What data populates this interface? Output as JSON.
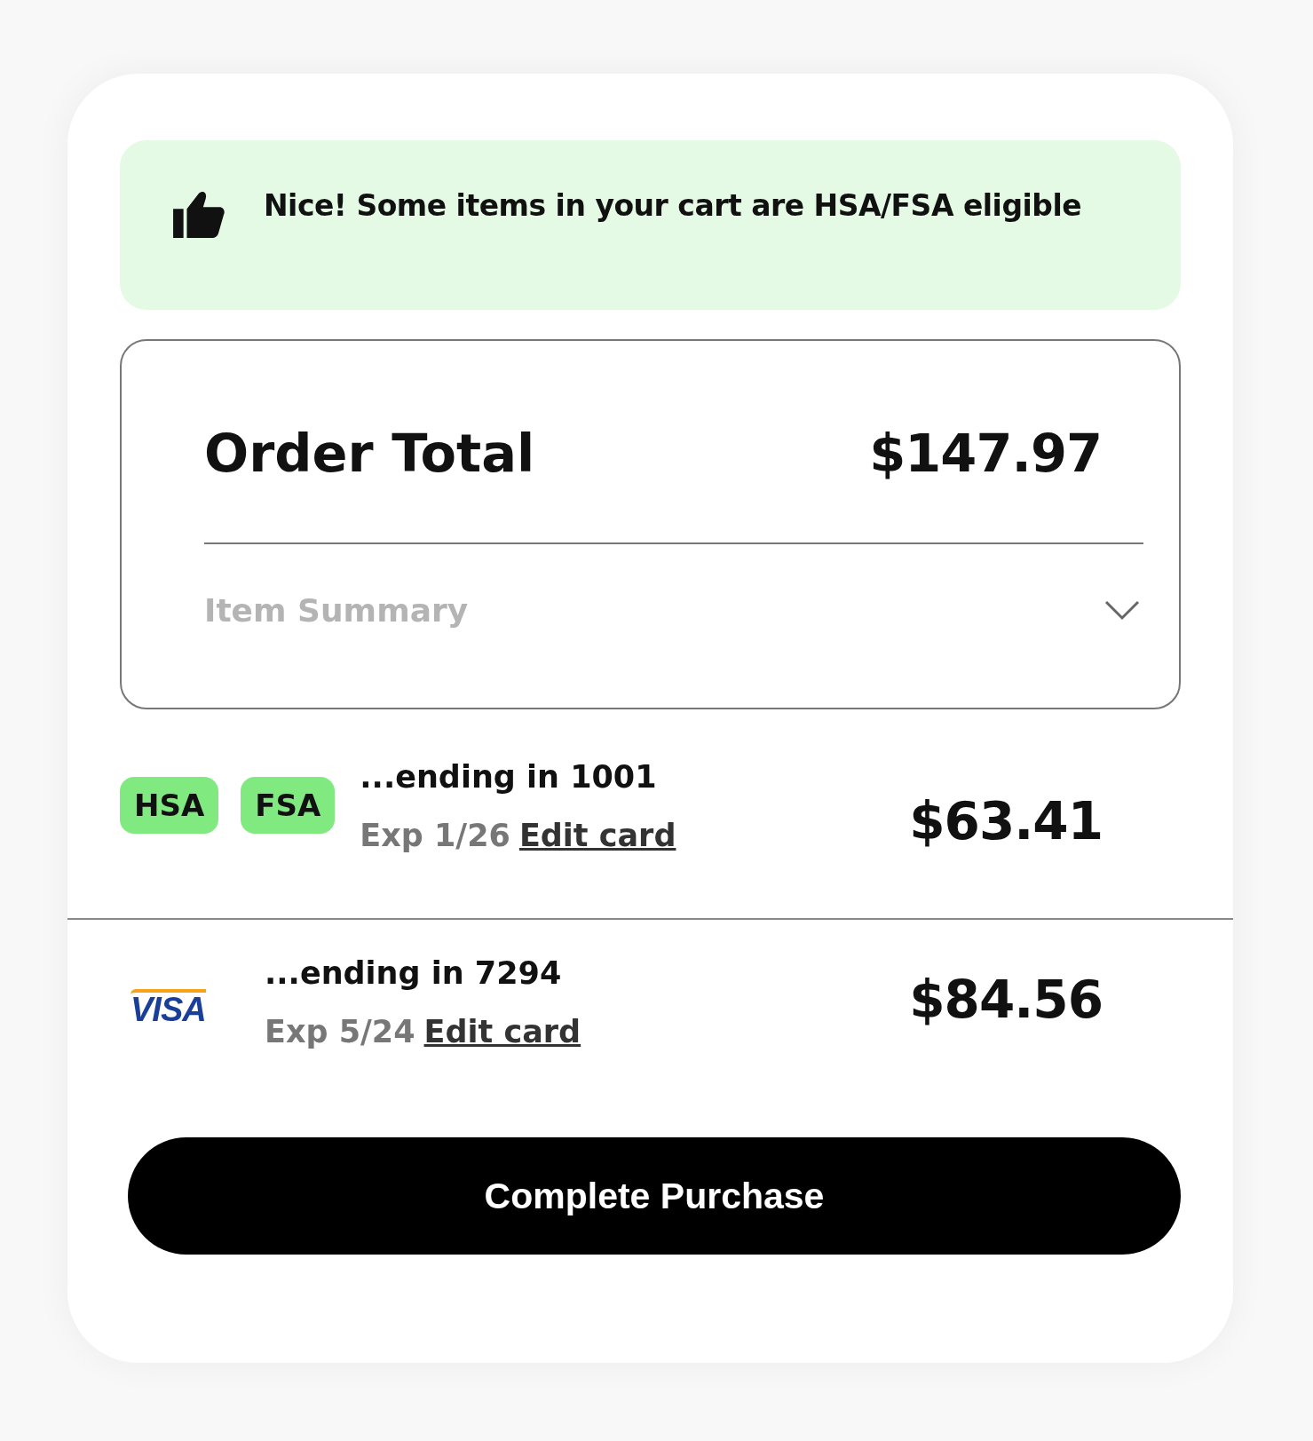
{
  "banner": {
    "text": "Nice! Some items in your cart are HSA/FSA eligible"
  },
  "order": {
    "label": "Order Total",
    "total": "$147.97",
    "summary_label": "Item Summary",
    "expanded": false
  },
  "payments": [
    {
      "kind": "badges",
      "badges": [
        "HSA",
        "FSA"
      ],
      "ending": "...ending in 1001",
      "exp": "Exp 1/26",
      "edit": "Edit card",
      "amount": "$63.41"
    },
    {
      "kind": "visa",
      "brand": "VISA",
      "ending": "...ending in 7294",
      "exp": "Exp 5/24",
      "edit": "Edit card",
      "amount": "$84.56"
    }
  ],
  "button": {
    "label": "Complete Purchase"
  }
}
